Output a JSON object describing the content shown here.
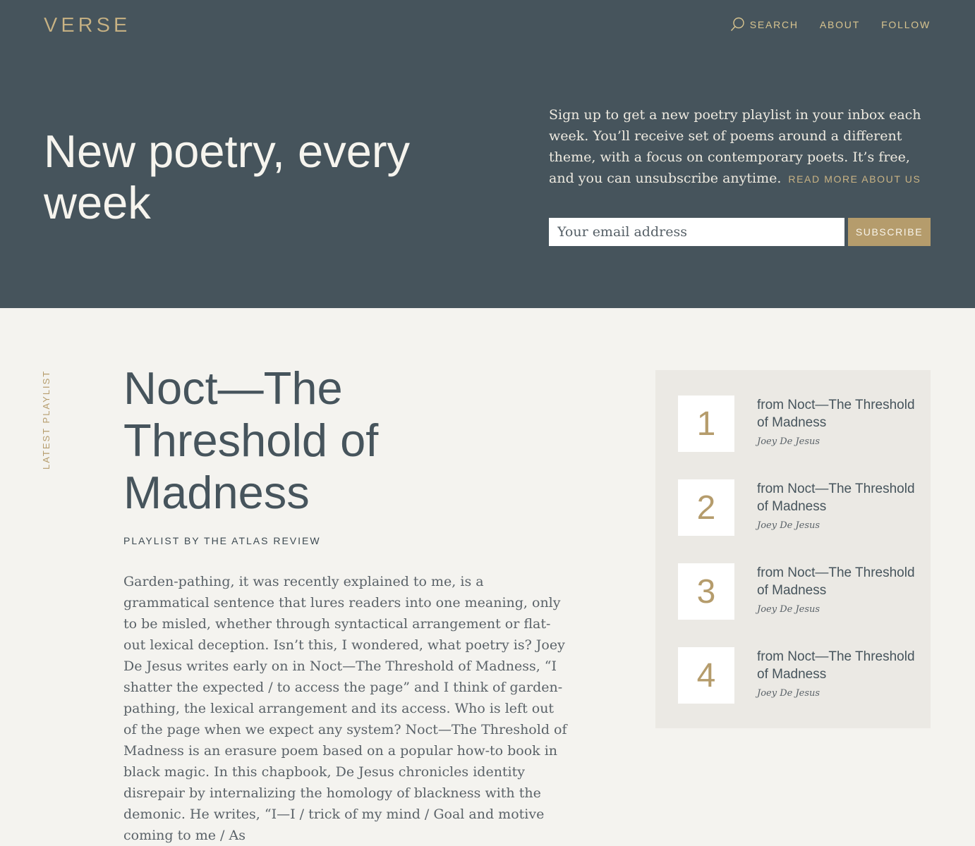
{
  "header": {
    "logo": "VERSE",
    "nav": [
      {
        "label": "SEARCH",
        "icon": "search-icon"
      },
      {
        "label": "ABOUT"
      },
      {
        "label": "FOLLOW"
      }
    ]
  },
  "hero": {
    "headline": "New poetry, every week",
    "signup_text": "Sign up to get a new poetry playlist in your inbox each week. You’ll receive set of poems around a different theme, with a focus on contemporary poets. It’s free, and you can unsubscribe anytime.",
    "read_more": "READ MORE ABOUT US",
    "email_placeholder": "Your email address",
    "subscribe_label": "SUBSCRIBE"
  },
  "latest": {
    "section_label": "LATEST PLAYLIST",
    "title": "Noct—The Threshold of Madness",
    "byline": "PLAYLIST BY THE ATLAS REVIEW",
    "description": "Garden-pathing, it was recently explained to me, is a grammatical sentence that lures readers into one meaning, only to be misled, whether through syntactical arrangement or flat-out lexical deception. Isn’t this, I wondered, what poetry is? Joey De Jesus writes early on in Noct—The Threshold of Madness, “I shatter the expected / to access the page” and I think of garden-pathing, the lexical arrangement and its access. Who is left out of the page when we expect any system? Noct—The Threshold of Madness is an erasure poem based on a popular how-to book in black magic. In this chapbook, De Jesus chronicles identity disrepair by internalizing the homology of blackness with the demonic. He writes, “I—I / trick of my mind / Goal and motive coming to me / As"
  },
  "tracks": [
    {
      "number": "1",
      "title": "from Noct—The Threshold of Madness",
      "author": "Joey De Jesus"
    },
    {
      "number": "2",
      "title": "from Noct—The Threshold of Madness",
      "author": "Joey De Jesus"
    },
    {
      "number": "3",
      "title": "from Noct—The Threshold of Madness",
      "author": "Joey De Jesus"
    },
    {
      "number": "4",
      "title": "from Noct—The Threshold of Madness",
      "author": "Joey De Jesus"
    }
  ],
  "colors": {
    "hero_bg": "#46545c",
    "accent_gold": "#b59c6c",
    "page_bg": "#f4f3ef",
    "sidebar_bg": "#ebe9e4"
  }
}
